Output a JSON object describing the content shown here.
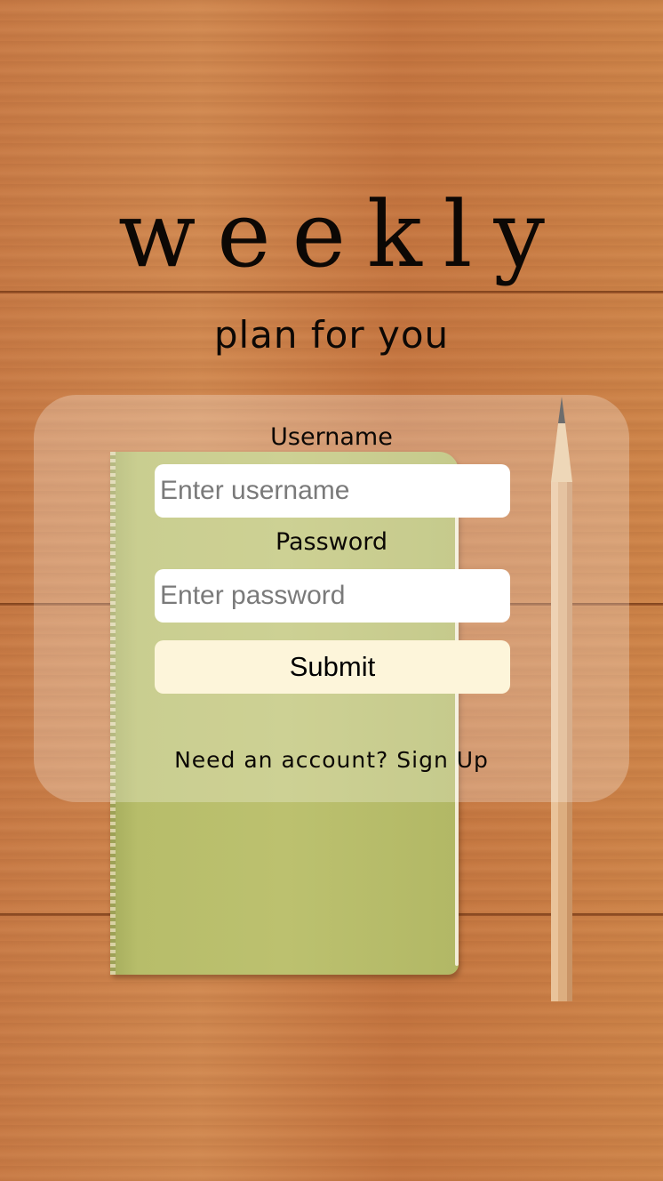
{
  "app": {
    "title": "weekly",
    "subtitle": "plan for you"
  },
  "login_form": {
    "username_label": "Username",
    "username_placeholder": "Enter username",
    "username_value": "",
    "password_label": "Password",
    "password_placeholder": "Enter password",
    "password_value": "",
    "submit_label": "Submit"
  },
  "footer": {
    "prompt_text": "Need an account?",
    "signup_link": "Sign Up"
  },
  "colors": {
    "wood": "#c97a42",
    "notebook": "#bcc16f",
    "submit_bg": "#fdf5da",
    "text": "#0c0805"
  }
}
